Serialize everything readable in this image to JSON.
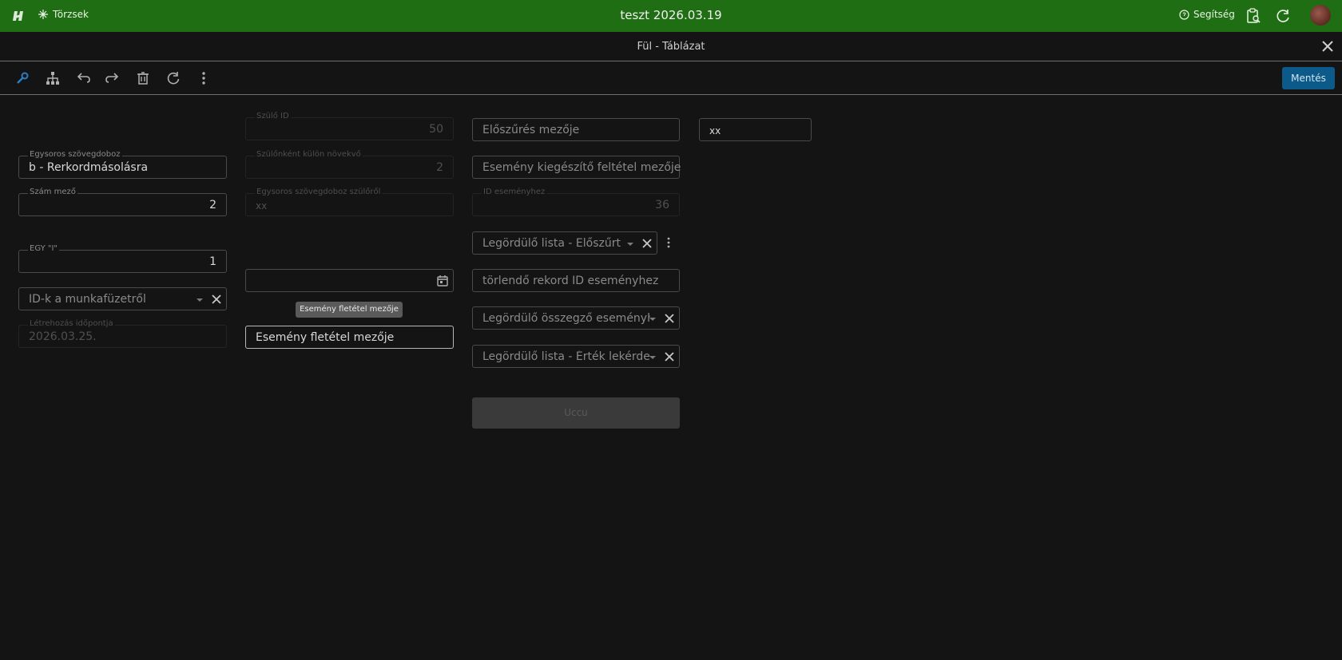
{
  "topbar": {
    "torzsek_label": "Törzsek",
    "title": "teszt 2026.03.19",
    "help_label": "Segítség",
    "bg_color": "#1f6e14"
  },
  "dialog": {
    "title": "Fül - Táblázat",
    "save_label": "Mentés",
    "save_color": "#0b5a8a"
  },
  "toolbar": {
    "icons": [
      "wrench-icon",
      "sitemap-icon",
      "undo-icon",
      "redo-icon",
      "trash-icon",
      "refresh-icon",
      "more-vertical-icon"
    ]
  },
  "col1": {
    "egysoros_label": "Egysoros szövegdoboz",
    "egysoros_value": "b - Rerkordmásolásra",
    "szam_label": "Szám mező",
    "szam_value": "2",
    "egy_label": "EGY \"I\"",
    "egy_value": "1",
    "idk_placeholder": "ID-k a munkafüzetről",
    "letrehozas_label": "Létrehozás időpontja",
    "letrehozas_value": "2026.03.25."
  },
  "col2": {
    "szulo_id_label": "Szülő ID",
    "szulo_id_value": "50",
    "szulonkent_label": "Szülőnként külön növekvő",
    "szulonkent_value": "2",
    "egysoros_szulo_label": "Egysoros szövegdoboz szülőről",
    "egysoros_szulo_value": "xx",
    "date_value": "",
    "tooltip": "Esemény fletétel mezője",
    "esemeny_placeholder": "Esemény fletétel mezője"
  },
  "col3": {
    "eloszures_placeholder": "Előszűrés mezője",
    "kiegeszito_placeholder": "Esemény kiegészítő feltétel mezője",
    "id_esemeny_label": "ID eseményhez",
    "id_esemeny_value": "36",
    "legordulo_eloszurt": "Legördülő lista - Előszűrt",
    "torlendo_placeholder": "törlendő rekord ID eseményhez",
    "legordulo_osszegzo": "Legördülő összegző eseményh...",
    "legordulo_ertek": "Legördülő lista - Érték lekérdez...",
    "uccu_label": "Uccu"
  },
  "col4": {
    "xx_value": "xx"
  }
}
